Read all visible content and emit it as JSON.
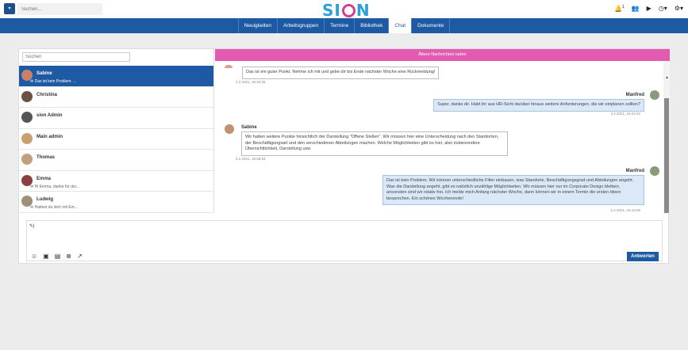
{
  "topbar": {
    "search_placeholder": "Suchen...",
    "logo_text": "SI N",
    "notification_count": "1"
  },
  "nav": [
    "Neuigkeiten",
    "Arbeitsgruppen",
    "Termine",
    "Bibliothek",
    "Chat",
    "Dokumente"
  ],
  "nav_active": "Chat",
  "sidebar": {
    "search_placeholder": "Suchen",
    "contacts": [
      {
        "name": "Sabine",
        "preview": "✉ Das ist kein Problem. ...",
        "active": true
      },
      {
        "name": "Christina",
        "preview": ""
      },
      {
        "name": "sion Admin",
        "preview": ""
      },
      {
        "name": "Main admin",
        "preview": ""
      },
      {
        "name": "Thomas",
        "preview": ""
      },
      {
        "name": "Emma",
        "preview": "✉ Hi Emma, danke für dei..."
      },
      {
        "name": "Ludwig",
        "preview": "✉ Hattest du dich mit Em..."
      }
    ]
  },
  "chat": {
    "older_label": "Ältere Nachrichten laden",
    "messages": [
      {
        "sender": "",
        "text": "Das ist ein guter Punkt. Nehme ich mit und gebe dir bis Ende nächster Woche eine Rückmeldung!",
        "time": "4.2.2021, 16:40:25",
        "out": false
      },
      {
        "sender": "Manfred",
        "text": "Super, danke dir. Habt ihr aus HR-Sicht darüber hinaus weitere Anforderungen, die wir einplanen sollten?",
        "time": "4.2.2021, 16:44:32",
        "out": true
      },
      {
        "sender": "Sabine",
        "text": "Wir hatten weitere Punkte hinsichtlich der Darstellung \"Offene Stellen\". Wir müssen hier eine Unterscheidung nach den Standorten, der Beschäftigungsart und den verschiedenen Abteilungen machen. Welche Möglichkeiten gibt es hier, also insbesondere Übersichtlichkeit, Darstellung usw.",
        "time": "4.2.2021, 16:58:53",
        "out": false
      },
      {
        "sender": "Manfred",
        "text": "Das ist kein Problem. Wir können unterschiedliche Filter einbauen, was Standorte, Beschäftigungsgrad und Abteilungen angeht. Was die Darstellung angeht, gibt es natürlich unzählige Möglichkeiten. Wir müssen hier nur im Corporate Design bleiben, ansonsten sind wir relativ frei. Ich melde mich Anfang nächster Woche, dann können wir in einem Termin die ersten Ideen besprechen. Ein schönes Wochenende!",
        "time": "5.2.2021, 15:19:09",
        "out": true
      }
    ]
  },
  "composer": {
    "send_label": "Antworten"
  },
  "colors": {
    "primary": "#1d5aa3",
    "accent": "#e25bb0",
    "logo": "#2a9fd8"
  }
}
